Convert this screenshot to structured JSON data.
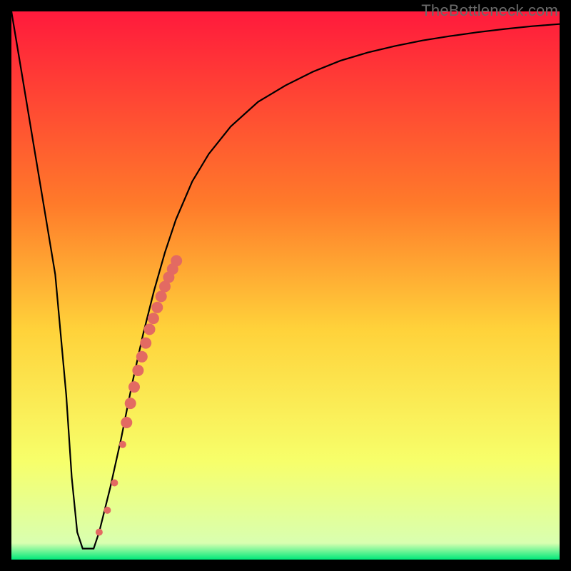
{
  "watermark": "TheBottleneck.com",
  "colors": {
    "frame": "#000000",
    "gradient_top": "#ff1a3c",
    "gradient_mid1": "#ff7a2a",
    "gradient_mid2": "#ffd23a",
    "gradient_mid3": "#f7ff6a",
    "gradient_bottom": "#00e97a",
    "curve": "#000000",
    "dots": "#e36a62"
  },
  "chart_data": {
    "type": "line",
    "title": "",
    "xlabel": "",
    "ylabel": "",
    "xlim": [
      0,
      100
    ],
    "ylim": [
      0,
      100
    ],
    "series": [
      {
        "name": "bottleneck-curve",
        "x": [
          0,
          2,
          4,
          6,
          8,
          10,
          11,
          12,
          13,
          14,
          15,
          16,
          18,
          20,
          22,
          24,
          26,
          28,
          30,
          33,
          36,
          40,
          45,
          50,
          55,
          60,
          65,
          70,
          75,
          80,
          85,
          90,
          95,
          100
        ],
        "y": [
          100,
          88,
          76,
          64,
          52,
          30,
          15,
          5,
          2,
          2,
          2,
          5,
          13,
          22,
          32,
          41,
          49,
          56,
          62,
          69,
          74,
          79,
          83.5,
          86.5,
          89,
          91,
          92.5,
          93.7,
          94.7,
          95.5,
          96.2,
          96.8,
          97.3,
          97.7
        ]
      }
    ],
    "overlay_points": {
      "name": "highlight-dots",
      "x": [
        16.0,
        17.5,
        18.8,
        20.3,
        21.0,
        21.7,
        22.4,
        23.1,
        23.8,
        24.5,
        25.2,
        25.9,
        26.6,
        27.3,
        28.0,
        28.7,
        29.4,
        30.1
      ],
      "y": [
        5.0,
        9.0,
        14.0,
        21.0,
        25.0,
        28.5,
        31.5,
        34.5,
        37.0,
        39.5,
        42.0,
        44.0,
        46.0,
        48.0,
        49.8,
        51.5,
        53.0,
        54.5
      ],
      "r": [
        5,
        5,
        5,
        5,
        8,
        8,
        8,
        8,
        8,
        8,
        8,
        8,
        8,
        8,
        8,
        8,
        8,
        8
      ]
    }
  }
}
